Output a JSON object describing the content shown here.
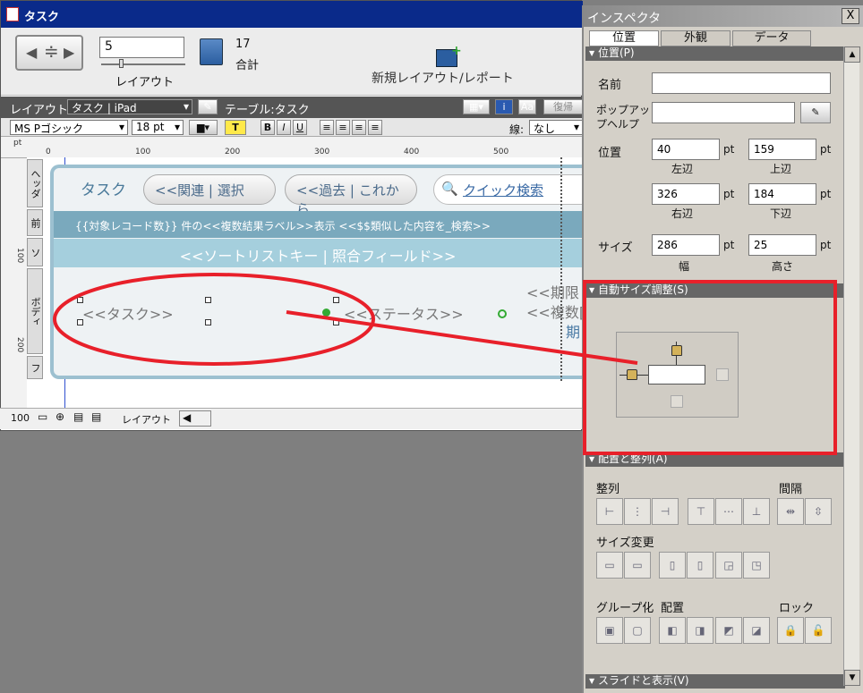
{
  "window": {
    "title": "タスク"
  },
  "toolbar": {
    "record_value": "5",
    "layout_label": "レイアウト",
    "count": "17",
    "count_label": "合計",
    "new_layout_label": "新規レイアウト/レポート"
  },
  "bar1": {
    "layout_prefix": "レイアウト:",
    "layout_value": "タスク | iPad",
    "table_label": "テーブル:タスク",
    "restore_label": "復帰"
  },
  "bar2": {
    "font": "MS Pゴシック",
    "size": "18 pt",
    "t_label": "T",
    "b": "B",
    "i": "I",
    "u": "U",
    "line_label": "線:",
    "line_value": "なし"
  },
  "ruler": {
    "top": [
      "0",
      "100",
      "200",
      "300",
      "400",
      "500"
    ],
    "left": [
      "100",
      "200"
    ],
    "unit": "pt"
  },
  "parts": {
    "header": "ヘッダ",
    "front": "前",
    "sub": "ソ",
    "body": "ボディ",
    "footer": "フ"
  },
  "layout": {
    "header_title": "タスク",
    "btn_related": "<<関連 | 選択",
    "btn_past": "<<過去 | これから",
    "quick_search": "クイック検索",
    "band1_text": "{{対象レコード数}} 件の<<複数結果ラベル>>表示  <<$$類似した内容を_検索>>",
    "band2_text": "<<ソートリストキー | 照合フィールド>>",
    "field_task": "<<タスク>>",
    "field_status": "<<ステータス>>",
    "field_due1": "<<期限",
    "field_due2": "<<複数[",
    "field_due3": "期"
  },
  "status": {
    "zoom": "100",
    "mode": "レイアウト"
  },
  "inspector": {
    "title": "インスペクタ",
    "close": "X",
    "tabs": [
      "位置",
      "外観",
      "データ"
    ],
    "sec_position": "位置(P)",
    "name_label": "名前",
    "popup_label_1": "ポップアッ",
    "popup_label_2": "プヘルプ",
    "pos_label": "位置",
    "left": "40",
    "top": "159",
    "right": "326",
    "bottom": "184",
    "left_label": "左辺",
    "top_label": "上辺",
    "right_label": "右辺",
    "bottom_label": "下辺",
    "unit": "pt",
    "size_label": "サイズ",
    "width": "286",
    "height": "25",
    "width_label": "幅",
    "height_label": "高さ",
    "sec_autosize": "自動サイズ調整(S)",
    "sec_arrange": "配置と整列(A)",
    "align_label": "整列",
    "spacing_label": "間隔",
    "resize_label": "サイズ変更",
    "group_label": "グループ化",
    "arrange_label": "配置",
    "lock_label": "ロック",
    "sec_slide": "スライドと表示(V)"
  },
  "annotation": {
    "color": "#e8202a"
  }
}
